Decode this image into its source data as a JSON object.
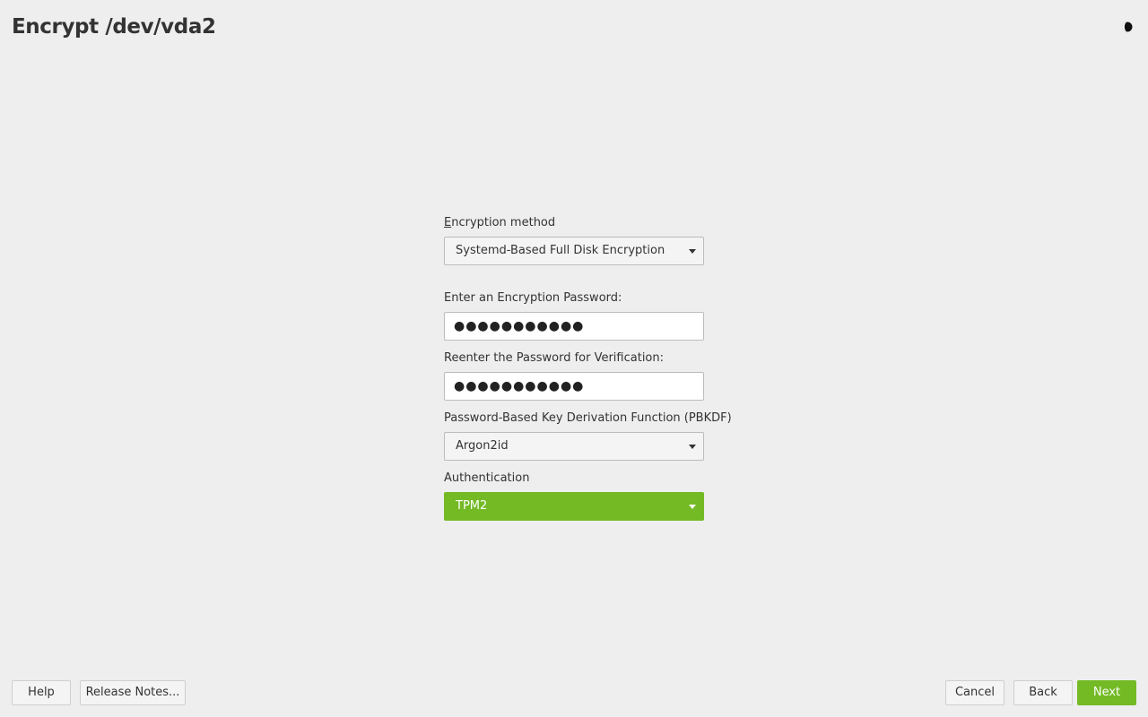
{
  "window": {
    "title": "Encrypt /dev/vda2",
    "theme_icon": "half-moon-icon"
  },
  "form": {
    "encryption_method": {
      "label": "Encryption method",
      "mnemonic": "E",
      "value": "Systemd-Based Full Disk Encryption"
    },
    "password": {
      "label": "Enter an Encryption Password:",
      "masked_value": "●●●●●●●●●●●"
    },
    "password_verify": {
      "label": "Reenter the Password for Verification:",
      "masked_value": "●●●●●●●●●●●"
    },
    "pbkdf": {
      "label": "Password-Based Key Derivation Function (PBKDF)",
      "value": "Argon2id"
    },
    "authentication": {
      "label": "Authentication",
      "value": "TPM2"
    }
  },
  "buttons": {
    "help": "Help",
    "release_notes": "Release Notes...",
    "cancel": "Cancel",
    "back": "Back",
    "next": "Next"
  },
  "colors": {
    "accent": "#73ba25",
    "background": "#eeeeee",
    "text": "#333333"
  }
}
